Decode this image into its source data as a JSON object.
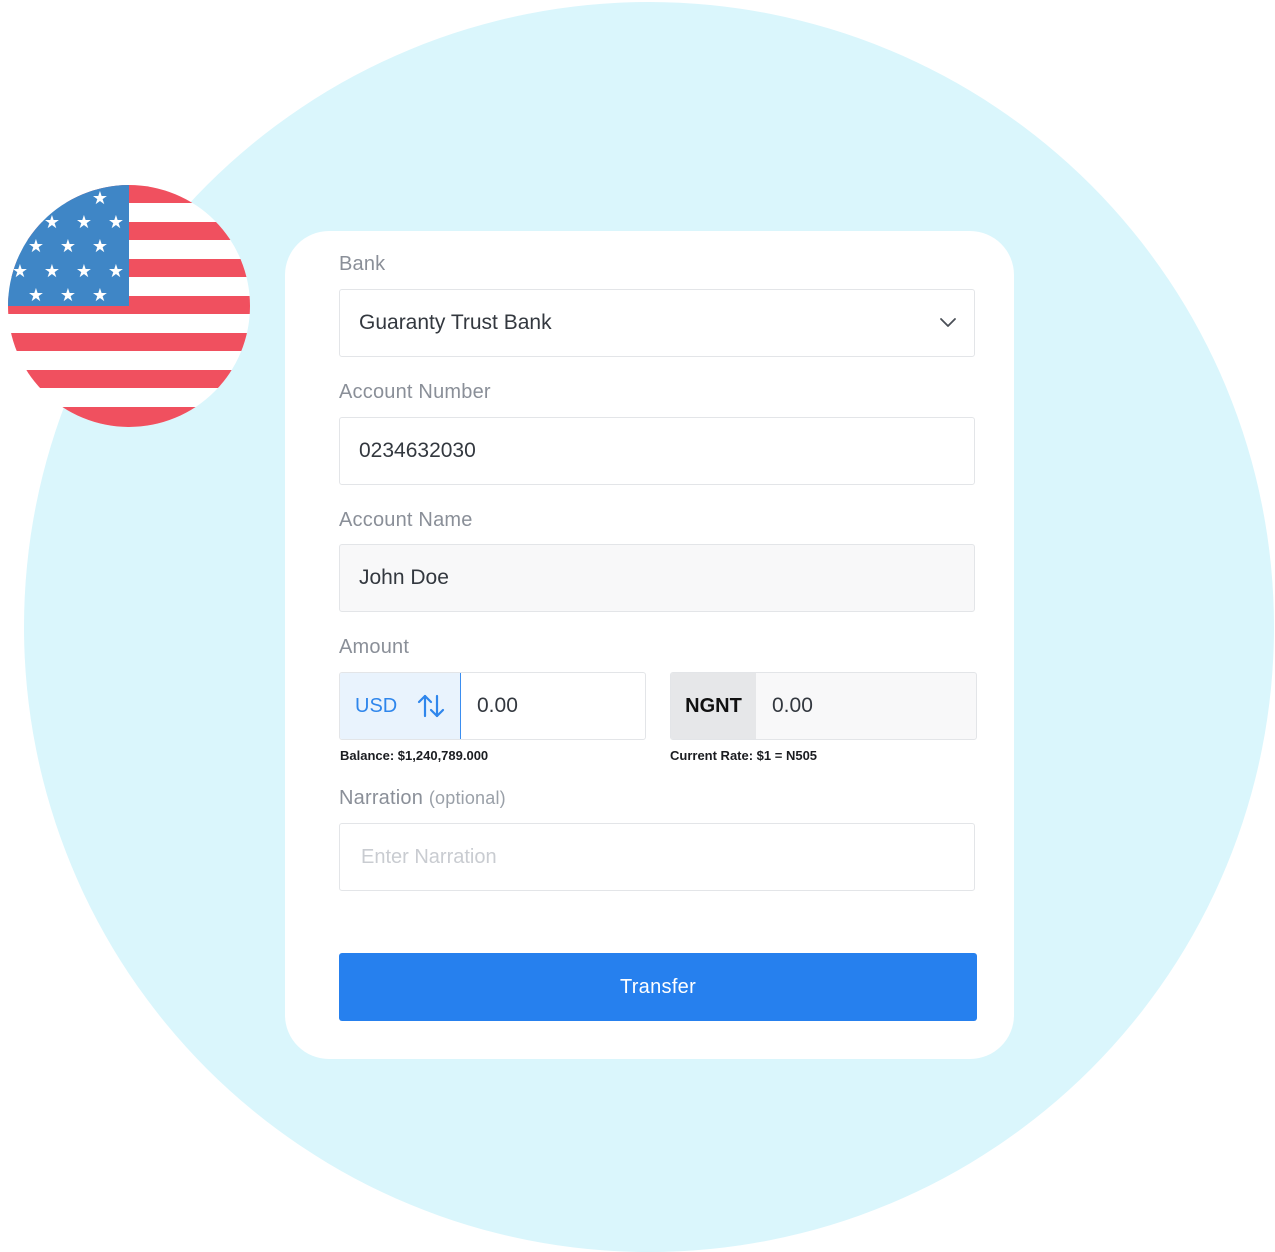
{
  "form": {
    "bank_label": "Bank",
    "bank_value": "Guaranty Trust Bank",
    "account_number_label": "Account Number",
    "account_number_value": "0234632030",
    "account_name_label": "Account Name",
    "account_name_value": "John Doe",
    "amount_label": "Amount",
    "source_currency": "USD",
    "source_amount": "0.00",
    "balance_text": "Balance: $1,240,789.000",
    "target_currency": "NGNT",
    "target_amount": "0.00",
    "rate_text": "Current Rate: $1 = N505",
    "narration_label": "Narration",
    "narration_optional": "(optional)",
    "narration_placeholder": "Enter Narration",
    "submit_label": "Transfer"
  },
  "colors": {
    "background_circle": "#daf6fc",
    "primary": "#2680ee",
    "flag_red": "#f0505f",
    "flag_blue": "#3f86c6"
  },
  "icons": {
    "flag": "us-flag-icon",
    "dropdown": "chevron-down-icon",
    "swap": "swap-vertical-icon"
  }
}
